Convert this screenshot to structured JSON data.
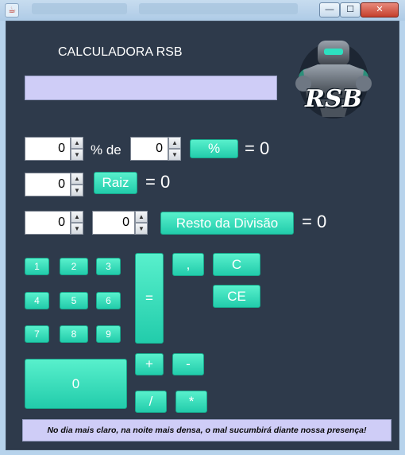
{
  "window": {
    "title_text": "",
    "minimize_glyph": "—",
    "maximize_glyph": "☐",
    "close_glyph": "✕"
  },
  "app": {
    "title": "CALCULADORA RSB",
    "display_value": "",
    "logo_text": "RSB"
  },
  "percent_row": {
    "a": "0",
    "of_label": "% de",
    "b": "0",
    "button": "%",
    "result": "= 0"
  },
  "sqrt_row": {
    "a": "0",
    "button": "Raiz",
    "result": "= 0"
  },
  "mod_row": {
    "a": "0",
    "b": "0",
    "button": "Resto da Divisão",
    "result": "= 0"
  },
  "spinner": {
    "up": "▲",
    "down": "▼"
  },
  "keypad": {
    "digits": [
      "1",
      "2",
      "3",
      "4",
      "5",
      "6",
      "7",
      "8",
      "9"
    ],
    "zero": "0",
    "equals": "=",
    "comma": ",",
    "clear": "C",
    "clear_entry": "CE",
    "plus": "+",
    "minus": "-",
    "divide": "/",
    "multiply": "*"
  },
  "footer": {
    "motto": "No dia mais claro, na noite mais densa, o mal sucumbirá diante nossa presença!"
  },
  "colors": {
    "frame_bg": "#2e3a4b",
    "accent": "#2ee0bd",
    "display_bg": "#cfcdf7"
  }
}
